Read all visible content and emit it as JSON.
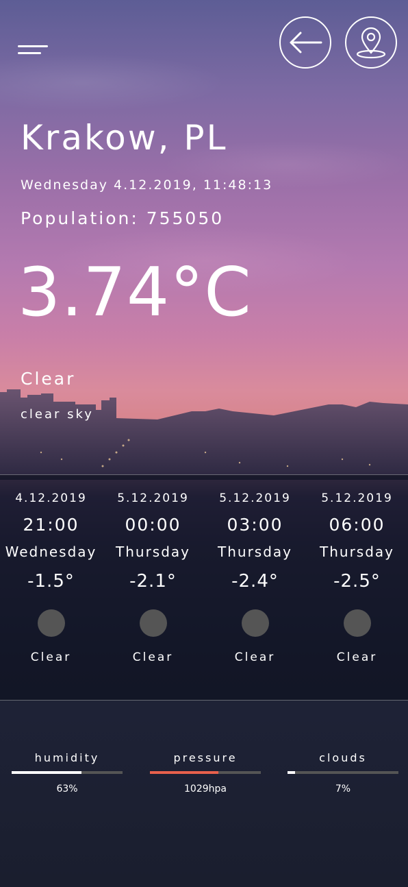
{
  "location": {
    "city": "Krakow, PL",
    "datetime": "Wednesday 4.12.2019, 11:48:13",
    "population": "Population: 755050"
  },
  "current": {
    "temperature": "3.74°C",
    "condition": "Clear",
    "description": "clear sky"
  },
  "forecast": [
    {
      "date": "4.12.2019",
      "time": "21:00",
      "day": "Wednesday",
      "temp": "-1.5°",
      "label": "Clear"
    },
    {
      "date": "5.12.2019",
      "time": "00:00",
      "day": "Thursday",
      "temp": "-2.1°",
      "label": "Clear"
    },
    {
      "date": "5.12.2019",
      "time": "03:00",
      "day": "Thursday",
      "temp": "-2.4°",
      "label": "Clear"
    },
    {
      "date": "5.12.2019",
      "time": "06:00",
      "day": "Thursday",
      "temp": "-2.5°",
      "label": "Clear"
    }
  ],
  "stats": {
    "humidity": {
      "title": "humidity",
      "value": "63%",
      "percent": 63,
      "color": "#ffffff"
    },
    "pressure": {
      "title": "pressure",
      "value": "1029hpa",
      "percent": 62,
      "color": "#e8604c"
    },
    "clouds": {
      "title": "clouds",
      "value": "7%",
      "percent": 7,
      "color": "#ffffff"
    }
  },
  "icons": {
    "menu": "menu-icon",
    "back": "arrow-left-icon",
    "location": "location-pin-icon",
    "weather": "weather-circle-icon"
  }
}
